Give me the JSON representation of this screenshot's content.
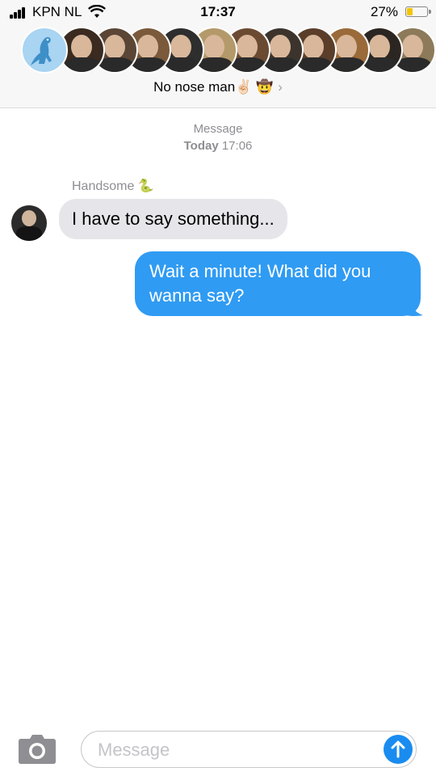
{
  "status_bar": {
    "carrier": "KPN NL",
    "time": "17:37",
    "battery_percent": "27%",
    "battery_level": 0.27
  },
  "header": {
    "group_icon": "dinosaur-icon",
    "avatar_count": 12,
    "title": "No nose man✌🏻 🤠",
    "chevron": "›"
  },
  "conversation": {
    "service_label": "Message",
    "date_prefix": "Today",
    "date_time": "17:06",
    "sender_name": "Handsome 🐍",
    "messages": [
      {
        "direction": "incoming",
        "text": "I have to say something..."
      },
      {
        "direction": "outgoing",
        "text": "Wait a minute! What did you wanna say?"
      }
    ]
  },
  "composer": {
    "placeholder": "Message",
    "value": "",
    "camera_icon": "camera-icon",
    "send_icon": "arrow-up-icon"
  },
  "colors": {
    "outgoing_bubble": "#2f9bf3",
    "incoming_bubble": "#e5e5ea",
    "send_button": "#1a8cf0",
    "group_avatar_bg": "#a9d4f2"
  }
}
